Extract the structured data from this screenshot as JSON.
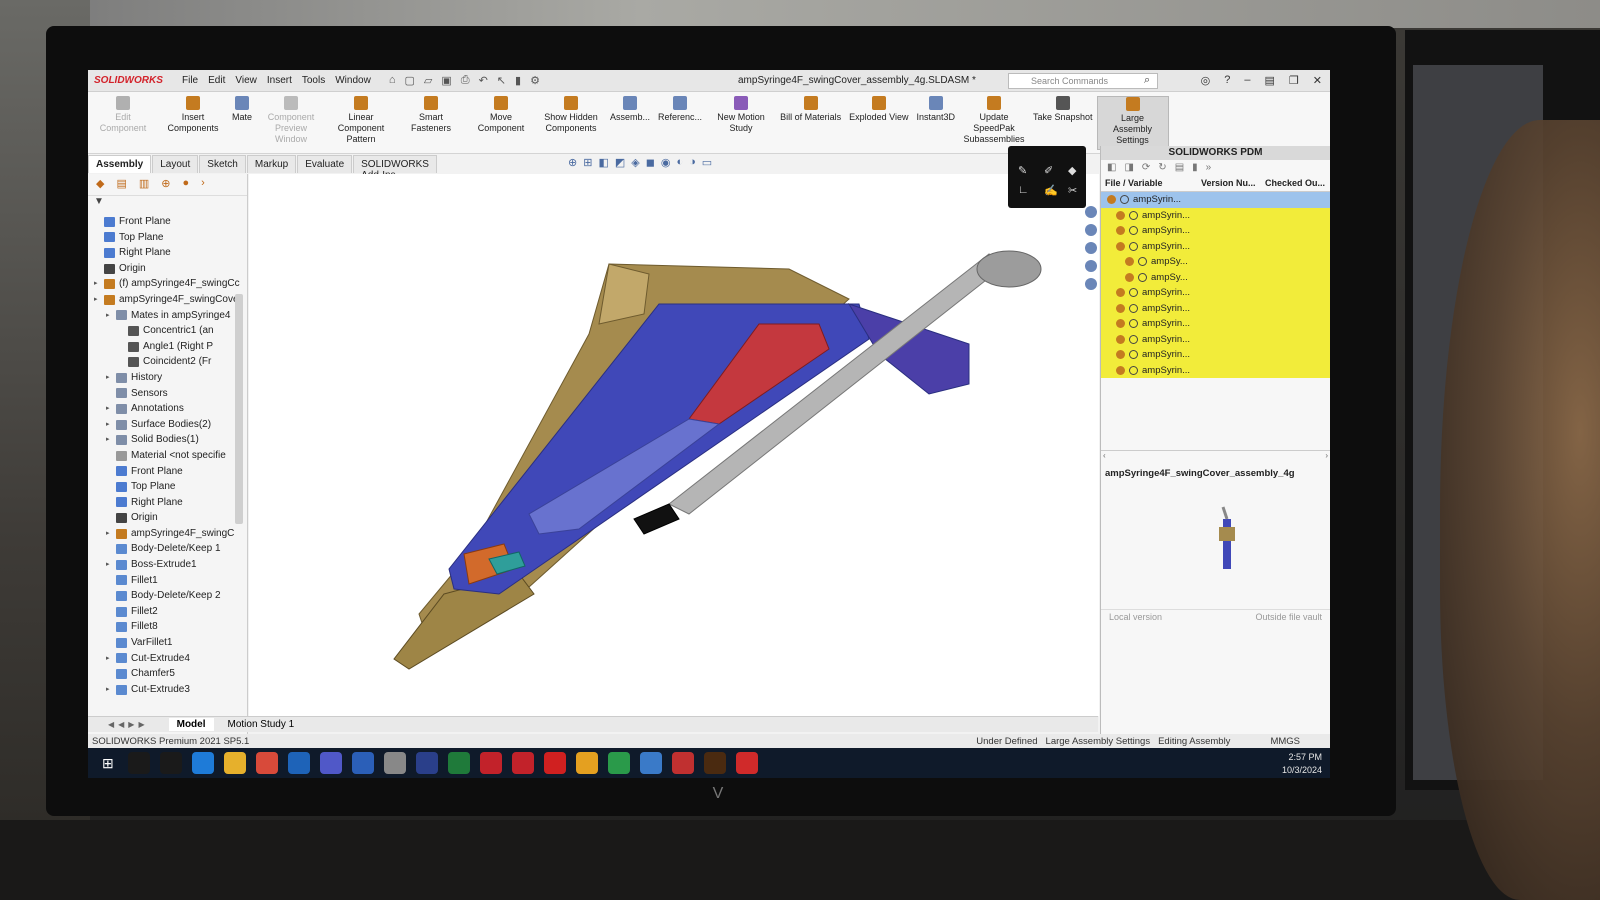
{
  "window": {
    "app_name": "SOLIDWORKS",
    "title": "ampSyringe4F_swingCover_assembly_4g.SLDASM *",
    "menu": [
      "File",
      "Edit",
      "View",
      "Insert",
      "Tools",
      "Window"
    ],
    "search_placeholder": "Search Commands"
  },
  "ribbon": {
    "buttons": [
      {
        "label": "Edit Component",
        "state": "disabled"
      },
      {
        "label": "Insert Components",
        "state": "enabled"
      },
      {
        "label": "Mate",
        "state": "enabled"
      },
      {
        "label": "Component Preview Window",
        "state": "disabled"
      },
      {
        "label": "Linear Component Pattern",
        "state": "enabled"
      },
      {
        "label": "Smart Fasteners",
        "state": "enabled"
      },
      {
        "label": "Move Component",
        "state": "enabled"
      },
      {
        "label": "Show Hidden Components",
        "state": "enabled"
      },
      {
        "label": "Assemb...",
        "state": "enabled"
      },
      {
        "label": "Referenc...",
        "state": "enabled"
      },
      {
        "label": "New Motion Study",
        "state": "enabled"
      },
      {
        "label": "Bill of Materials",
        "state": "enabled"
      },
      {
        "label": "Exploded View",
        "state": "enabled"
      },
      {
        "label": "Instant3D",
        "state": "enabled"
      },
      {
        "label": "Update SpeedPak Subassemblies",
        "state": "enabled"
      },
      {
        "label": "Take Snapshot",
        "state": "enabled"
      },
      {
        "label": "Large Assembly Settings",
        "state": "active"
      }
    ]
  },
  "command_tabs": [
    "Assembly",
    "Layout",
    "Sketch",
    "Markup",
    "Evaluate",
    "SOLIDWORKS Add-Ins"
  ],
  "feature_tree": [
    {
      "label": "Front Plane",
      "indent": 0,
      "type": "plane"
    },
    {
      "label": "Top Plane",
      "indent": 0,
      "type": "plane"
    },
    {
      "label": "Right Plane",
      "indent": 0,
      "type": "plane"
    },
    {
      "label": "Origin",
      "indent": 0,
      "type": "origin"
    },
    {
      "label": "(f) ampSyringe4F_swingCc",
      "indent": 0,
      "type": "part",
      "expand": true
    },
    {
      "label": "ampSyringe4F_swingCove",
      "indent": 0,
      "type": "part",
      "expand": true
    },
    {
      "label": "Mates in ampSyringe4",
      "indent": 1,
      "type": "folder",
      "expand": true
    },
    {
      "label": "Concentric1 (an",
      "indent": 2,
      "type": "mate"
    },
    {
      "label": "Angle1 (Right P",
      "indent": 2,
      "type": "mate"
    },
    {
      "label": "Coincident2 (Fr",
      "indent": 2,
      "type": "mate"
    },
    {
      "label": "History",
      "indent": 1,
      "type": "folder",
      "expand": true
    },
    {
      "label": "Sensors",
      "indent": 1,
      "type": "folder"
    },
    {
      "label": "Annotations",
      "indent": 1,
      "type": "folder",
      "expand": true
    },
    {
      "label": "Surface Bodies(2)",
      "indent": 1,
      "type": "folder",
      "expand": true
    },
    {
      "label": "Solid Bodies(1)",
      "indent": 1,
      "type": "folder",
      "expand": true
    },
    {
      "label": "Material <not specifie",
      "indent": 1,
      "type": "material"
    },
    {
      "label": "Front Plane",
      "indent": 1,
      "type": "plane"
    },
    {
      "label": "Top Plane",
      "indent": 1,
      "type": "plane"
    },
    {
      "label": "Right Plane",
      "indent": 1,
      "type": "plane"
    },
    {
      "label": "Origin",
      "indent": 1,
      "type": "origin"
    },
    {
      "label": "ampSyringe4F_swingC",
      "indent": 1,
      "type": "part",
      "expand": true
    },
    {
      "label": "Body-Delete/Keep 1",
      "indent": 1,
      "type": "feature"
    },
    {
      "label": "Boss-Extrude1",
      "indent": 1,
      "type": "feature",
      "expand": true
    },
    {
      "label": "Fillet1",
      "indent": 1,
      "type": "feature"
    },
    {
      "label": "Body-Delete/Keep 2",
      "indent": 1,
      "type": "feature"
    },
    {
      "label": "Fillet2",
      "indent": 1,
      "type": "feature"
    },
    {
      "label": "Fillet8",
      "indent": 1,
      "type": "feature"
    },
    {
      "label": "VarFillet1",
      "indent": 1,
      "type": "feature"
    },
    {
      "label": "Cut-Extrude4",
      "indent": 1,
      "type": "feature",
      "expand": true
    },
    {
      "label": "Chamfer5",
      "indent": 1,
      "type": "feature"
    },
    {
      "label": "Cut-Extrude3",
      "indent": 1,
      "type": "feature",
      "expand": true
    }
  ],
  "bottom_tabs": {
    "model": "Model",
    "motion": "Motion Study 1"
  },
  "pdm": {
    "title": "SOLIDWORKS PDM",
    "columns": [
      "File / Variable",
      "Version Nu...",
      "Checked Ou..."
    ],
    "rows": [
      {
        "label": "ampSyrin...",
        "indent": 0,
        "selected": true
      },
      {
        "label": "ampSyrin...",
        "indent": 1
      },
      {
        "label": "ampSyrin...",
        "indent": 1
      },
      {
        "label": "ampSyrin...",
        "indent": 1
      },
      {
        "label": "ampSy...",
        "indent": 2
      },
      {
        "label": "ampSy...",
        "indent": 2
      },
      {
        "label": "ampSyrin...",
        "indent": 1
      },
      {
        "label": "ampSyrin...",
        "indent": 1
      },
      {
        "label": "ampSyrin...",
        "indent": 1
      },
      {
        "label": "ampSyrin...",
        "indent": 1
      },
      {
        "label": "ampSyrin...",
        "indent": 1
      },
      {
        "label": "ampSyrin...",
        "indent": 1
      }
    ],
    "preview_title": "ampSyringe4F_swingCover_assembly_4g",
    "footer_left": "Local version",
    "footer_right": "Outside file vault"
  },
  "status": {
    "product": "SOLIDWORKS Premium 2021 SP5.1",
    "definition": "Under Defined",
    "mode": "Large Assembly Settings",
    "editing": "Editing Assembly",
    "units": "MMGS"
  },
  "taskbar": {
    "time": "2:57 PM",
    "date": "10/3/2024",
    "apps": [
      "search-icon",
      "task-view-icon",
      "edge-icon",
      "file-explorer-icon",
      "photos-icon",
      "outlook-icon",
      "teams-icon",
      "word-icon",
      "app-icon",
      "photoshop-icon",
      "excel-icon",
      "solidworks-icon",
      "solidworks-visualize-icon",
      "acrobat-icon",
      "chrome-icon",
      "chrome-alt-icon",
      "pdm-icon",
      "game-icon",
      "illustrator-icon",
      "media-icon"
    ]
  },
  "colors": {
    "accent_red": "#d3222a",
    "pdm_highlight": "#f2ec3a",
    "selection_blue": "#9dc3ec",
    "model_tan": "#a58b4e",
    "model_blue": "#4048b8",
    "model_red": "#c4383e",
    "model_gray": "#b5b5b5"
  }
}
